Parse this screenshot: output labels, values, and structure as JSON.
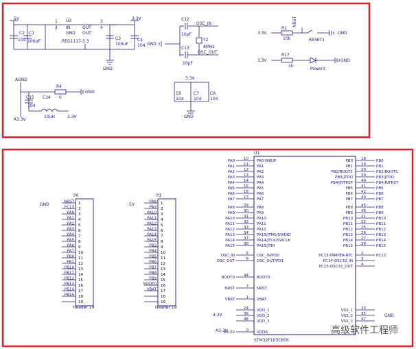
{
  "power": {
    "v3v3": "3.3V",
    "v5": "5V",
    "gnd": "GND",
    "agnd": "AGND",
    "a3v3": "A3.3V"
  },
  "ldo": {
    "ref": "U3",
    "part": "REG1117-3.3",
    "pin_in": "IN",
    "pin_out_top": "OUT",
    "pin_gnd": "GND",
    "pin_out_bot": "OUT",
    "n1": "1",
    "n2": "2",
    "n3": "3",
    "n4": "4",
    "c1": "C1",
    "c1v": "104",
    "c2": "C2",
    "c2v": "100uF",
    "c3": "C3",
    "c3v": "100uF",
    "c4": "C4",
    "c4v": "104"
  },
  "osc": {
    "c12": "C12",
    "c12v": "10pF",
    "c13": "C13",
    "c13v": "10pF",
    "y2": "Y2",
    "y2v": "8MHz",
    "net_in": "OSC_IN",
    "net_out": "OSC_OUT"
  },
  "reset": {
    "r1": "R1",
    "r1v": "10k",
    "net": "NRST",
    "sw": "RESET1"
  },
  "led": {
    "r17": "R17",
    "r17v": "1k",
    "label": "Power1"
  },
  "analog": {
    "r4": "R4",
    "r4v": "0",
    "c14": "C14",
    "c15": "C15",
    "c15v": "104",
    "l": "10uH"
  },
  "decap": {
    "c6": "C6",
    "c6v": "104",
    "c7": "C7",
    "c7v": "104",
    "c8": "C8",
    "c8v": "104"
  },
  "mcu": {
    "ref": "U1",
    "part": "STM32F103C8T6",
    "left": [
      {
        "net": "PA0",
        "pin": "PA0-WKUP",
        "num": "10"
      },
      {
        "net": "PA1",
        "pin": "PA1",
        "num": "11"
      },
      {
        "net": "PA2",
        "pin": "PA2",
        "num": "12"
      },
      {
        "net": "PA3",
        "pin": "PA3",
        "num": "13"
      },
      {
        "net": "PA4",
        "pin": "PA4",
        "num": "14"
      },
      {
        "net": "PA5",
        "pin": "PA5",
        "num": "15"
      },
      {
        "net": "PA6",
        "pin": "PA6",
        "num": "16"
      },
      {
        "net": "PA7",
        "pin": "PA7",
        "num": "17"
      },
      {
        "net": "PA8",
        "pin": "PA8",
        "num": "29"
      },
      {
        "net": "PA9",
        "pin": "PA9",
        "num": "30"
      },
      {
        "net": "PA10",
        "pin": "PA10",
        "num": "31"
      },
      {
        "net": "PA11",
        "pin": "PA11",
        "num": "32"
      },
      {
        "net": "PA12",
        "pin": "PA12",
        "num": "33"
      },
      {
        "net": "PA13",
        "pin": "PA13/JTMS/SWDIO",
        "num": "34"
      },
      {
        "net": "PA14",
        "pin": "PA14/JTCK/SWCLK",
        "num": "37"
      },
      {
        "net": "PA15",
        "pin": "PA15/JTDI",
        "num": "38"
      },
      {
        "net": "OSC_IN",
        "pin": "OSC_IN/PD0",
        "num": "5"
      },
      {
        "net": "OSC_OUT",
        "pin": "OSC_OUT/PD1",
        "num": "6"
      },
      {
        "net": "BOOT0",
        "pin": "BOOT0",
        "num": "44"
      },
      {
        "net": "NRST",
        "pin": "NRST",
        "num": "7"
      },
      {
        "net": "VBAT",
        "pin": "VBAT",
        "num": "1"
      },
      {
        "net": "",
        "pin": "VDD_1",
        "num": "24"
      },
      {
        "net": "",
        "pin": "VDD_2",
        "num": "36"
      },
      {
        "net": "",
        "pin": "VDD_3",
        "num": "48"
      },
      {
        "net": "A3.3V",
        "pin": "VDDA",
        "num": "9"
      }
    ],
    "right": [
      {
        "net": "PB0",
        "pin": "PB0",
        "num": "18"
      },
      {
        "net": "PB1",
        "pin": "PB1",
        "num": "19"
      },
      {
        "net": "PB2/BOOT1",
        "pin": "PB2/BOOT1",
        "num": "20"
      },
      {
        "net": "PB3/JTDO",
        "pin": "PB3/JTDO",
        "num": "39"
      },
      {
        "net": "PB4/INTRST",
        "pin": "PB4/JNTRST",
        "num": "40"
      },
      {
        "net": "PB5",
        "pin": "PB5",
        "num": "41"
      },
      {
        "net": "PB6",
        "pin": "PB6",
        "num": "42"
      },
      {
        "net": "PB7",
        "pin": "PB7",
        "num": "43"
      },
      {
        "net": "PB8",
        "pin": "PB8",
        "num": "45"
      },
      {
        "net": "PB9",
        "pin": "PB9",
        "num": "46"
      },
      {
        "net": "PB10",
        "pin": "PB10",
        "num": "21"
      },
      {
        "net": "PB11",
        "pin": "PB11",
        "num": "22"
      },
      {
        "net": "PB12",
        "pin": "PB12",
        "num": "25"
      },
      {
        "net": "PB13",
        "pin": "PB13",
        "num": "26"
      },
      {
        "net": "PB14",
        "pin": "PB14",
        "num": "27"
      },
      {
        "net": "PB15",
        "pin": "PB15",
        "num": "28"
      },
      {
        "net": "PC13",
        "pin": "PC13-TAMPER-RTC",
        "num": "2"
      },
      {
        "net": "",
        "pin": "PC14-OSC32_IN",
        "num": "3"
      },
      {
        "net": "",
        "pin": "PC15-OSC32_OUT",
        "num": "4"
      },
      {
        "net": "",
        "pin": "VSS_1",
        "num": "23"
      },
      {
        "net": "",
        "pin": "VSS_2",
        "num": "35"
      },
      {
        "net": "",
        "pin": "VSS_3",
        "num": "47"
      }
    ]
  },
  "p0": {
    "ref": "P0",
    "name": "Header 19",
    "nets": [
      "NRST",
      "PC13",
      "PA0",
      "PA1",
      "PA2",
      "PA3",
      "PA4",
      "PA5",
      "PA6",
      "PA7",
      "PB0",
      "PB1",
      "PB10",
      "PB11",
      "PB12",
      "PB13",
      "PB14",
      "PB15",
      ""
    ]
  },
  "p1": {
    "ref": "P1",
    "name": "Header 19",
    "nets": [
      "PA8",
      "PA9",
      "PA10",
      "PA11",
      "PA12",
      "PA13",
      "PA14",
      "PA15",
      "PB3",
      "PB4",
      "PB5",
      "PB6",
      "PB7",
      "PB8",
      "PB9",
      "BOOT0",
      "VBAT",
      "",
      ""
    ]
  },
  "watermark": "高级软件工程师"
}
